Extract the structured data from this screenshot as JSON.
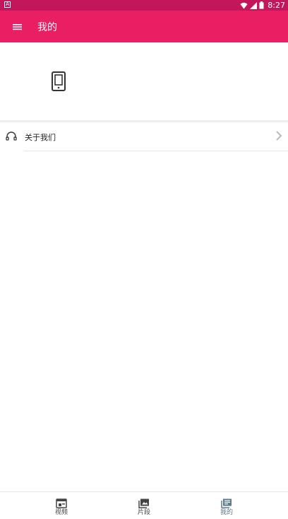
{
  "status_bar": {
    "time": "8:27",
    "left_badge": "A"
  },
  "app_bar": {
    "title": "我的",
    "menu_icon": "hamburger-menu-icon"
  },
  "profile": {
    "icon": "smartphone-icon"
  },
  "menu": {
    "items": [
      {
        "label": "关于我们",
        "icon": "headset-icon",
        "chevron": "chevron-right-icon"
      }
    ]
  },
  "bottom_nav": {
    "items": [
      {
        "label": "视频",
        "icon": "video-feed-icon",
        "active": false
      },
      {
        "label": "片段",
        "icon": "photo-library-icon",
        "active": false
      },
      {
        "label": "我的",
        "icon": "library-books-icon",
        "active": true
      }
    ]
  },
  "colors": {
    "status_bar": "#c2185b",
    "app_bar": "#e91e63",
    "nav_active": "#5b7a8c",
    "nav_inactive": "#444444"
  }
}
